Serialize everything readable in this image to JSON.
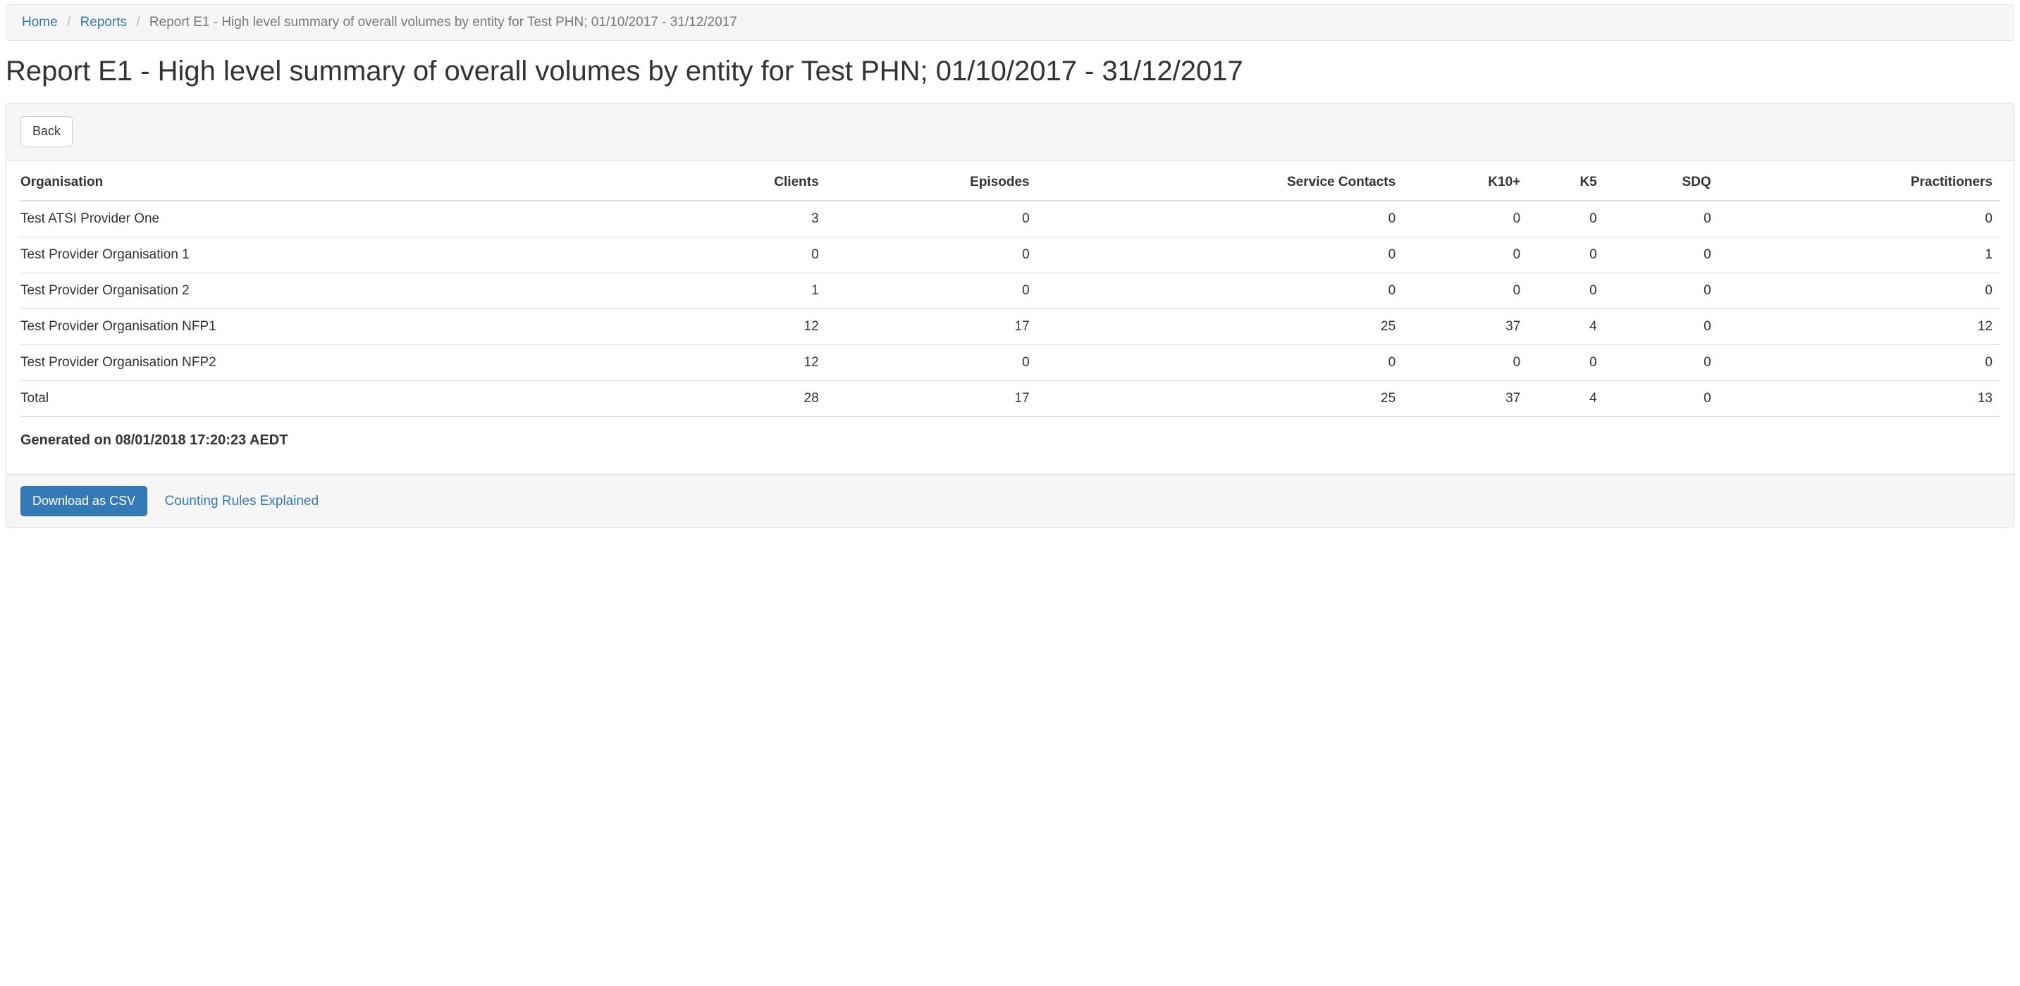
{
  "breadcrumb": {
    "home": "Home",
    "reports": "Reports",
    "current": "Report E1 - High level summary of overall volumes by entity for Test PHN; 01/10/2017 - 31/12/2017"
  },
  "title": "Report E1 - High level summary of overall volumes by entity for Test PHN; 01/10/2017 - 31/12/2017",
  "back_label": "Back",
  "table": {
    "headers": {
      "organisation": "Organisation",
      "clients": "Clients",
      "episodes": "Episodes",
      "service_contacts": "Service Contacts",
      "k10plus": "K10+",
      "k5": "K5",
      "sdq": "SDQ",
      "practitioners": "Practitioners"
    },
    "rows": [
      {
        "organisation": "Test ATSI Provider One",
        "clients": "3",
        "episodes": "0",
        "service_contacts": "0",
        "k10plus": "0",
        "k5": "0",
        "sdq": "0",
        "practitioners": "0"
      },
      {
        "organisation": "Test Provider Organisation 1",
        "clients": "0",
        "episodes": "0",
        "service_contacts": "0",
        "k10plus": "0",
        "k5": "0",
        "sdq": "0",
        "practitioners": "1"
      },
      {
        "organisation": "Test Provider Organisation 2",
        "clients": "1",
        "episodes": "0",
        "service_contacts": "0",
        "k10plus": "0",
        "k5": "0",
        "sdq": "0",
        "practitioners": "0"
      },
      {
        "organisation": "Test Provider Organisation NFP1",
        "clients": "12",
        "episodes": "17",
        "service_contacts": "25",
        "k10plus": "37",
        "k5": "4",
        "sdq": "0",
        "practitioners": "12"
      },
      {
        "organisation": "Test Provider Organisation NFP2",
        "clients": "12",
        "episodes": "0",
        "service_contacts": "0",
        "k10plus": "0",
        "k5": "0",
        "sdq": "0",
        "practitioners": "0"
      },
      {
        "organisation": "Total",
        "clients": "28",
        "episodes": "17",
        "service_contacts": "25",
        "k10plus": "37",
        "k5": "4",
        "sdq": "0",
        "practitioners": "13"
      }
    ]
  },
  "generated": "Generated on 08/01/2018 17:20:23 AEDT",
  "footer": {
    "download_csv": "Download as CSV",
    "counting_rules": "Counting Rules Explained"
  }
}
